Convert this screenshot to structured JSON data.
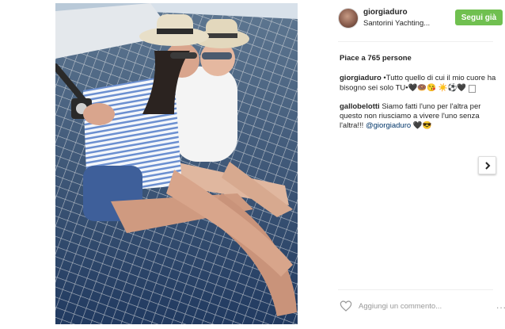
{
  "post": {
    "username": "giorgiaduro",
    "location": "Santorini Yachting...",
    "follow_label": "Segui già",
    "likes": "Piace a 765 persone",
    "comments": [
      {
        "user": "giorgiaduro",
        "text": "•Tutto quello di cui il mio cuore ha bisogno sei solo TU•🖤🍩😘 ☀️⚽️🖤"
      },
      {
        "user": "gallobelotti",
        "text": "Siamo fatti l'uno per l'altra per questo non riusciamo a vivere l'uno senza l'altra!!!",
        "mention": "@giorgiaduro",
        "suffix": "🖤😎"
      }
    ],
    "add_comment_placeholder": "Aggiungi un commento...",
    "more_label": "..."
  },
  "colors": {
    "follow_button": "#70c050",
    "mention": "#003569"
  },
  "icons": {
    "like": "heart-icon",
    "next": "chevron-right-icon"
  }
}
